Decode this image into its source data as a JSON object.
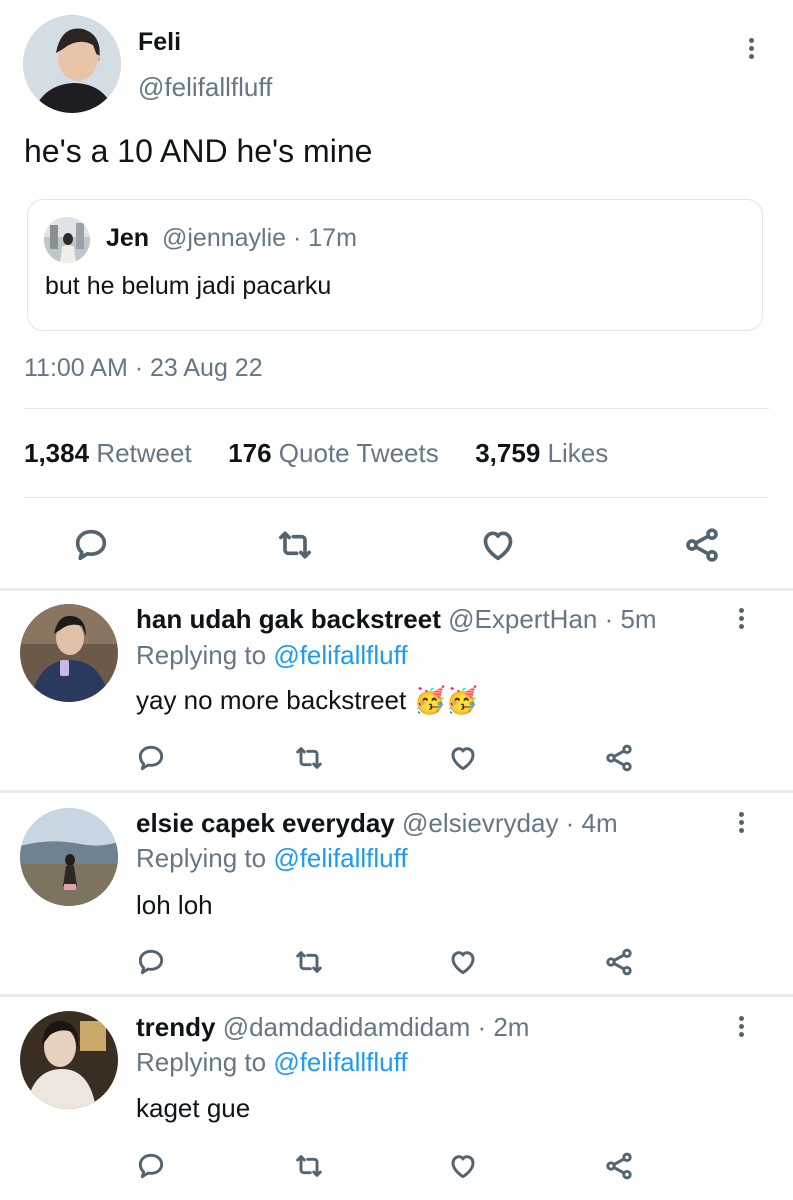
{
  "tweet": {
    "name": "Feli",
    "handle": "@felifallfluff",
    "text": "he's a 10 AND he's mine",
    "quote": {
      "name": "Jen",
      "meta": "@jennaylie · 17m",
      "text": "but he belum jadi pacarku"
    },
    "timestamp": "11:00 AM · 23 Aug 22",
    "stats": {
      "retweets_count": "1,384",
      "retweets_label": "Retweet",
      "quotes_count": "176",
      "quotes_label": "Quote Tweets",
      "likes_count": "3,759",
      "likes_label": "Likes"
    }
  },
  "replies": [
    {
      "name": "han udah gak backstreet",
      "meta": "@ExpertHan · 5m",
      "replying_label": "Replying to",
      "replying_handle": "@felifallfluff",
      "text": "yay no more backstreet",
      "emoji": "🥳🥳"
    },
    {
      "name": "elsie capek everyday",
      "meta": "@elsievryday · 4m",
      "replying_label": "Replying to",
      "replying_handle": "@felifallfluff",
      "text": "loh loh"
    },
    {
      "name": "trendy",
      "meta": "@damdadidamdidam · 2m",
      "replying_label": "Replying to",
      "replying_handle": "@felifallfluff",
      "text": "kaget gue"
    }
  ],
  "colors": {
    "accent": "#1d9bf0",
    "muted": "#657786",
    "divider": "#e1e8ed"
  },
  "icons": [
    "more-icon",
    "reply-icon",
    "retweet-icon",
    "like-icon",
    "share-icon"
  ]
}
